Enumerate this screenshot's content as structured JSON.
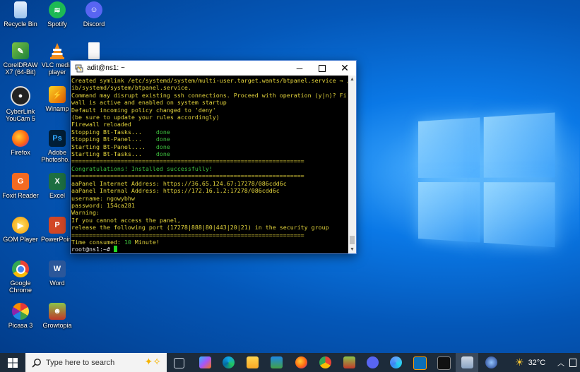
{
  "desktop": {
    "icons": [
      {
        "label": "Recycle Bin"
      },
      {
        "label": "Spotify"
      },
      {
        "label": "Discord"
      },
      {
        "label": "CorelDRAW X7 (64-Bit)"
      },
      {
        "label": "VLC media player"
      },
      {
        "label": ""
      },
      {
        "label": "CyberLink YouCam 5"
      },
      {
        "label": "Winamp"
      },
      {
        "label": "Firefox"
      },
      {
        "label": "Adobe Photosho..."
      },
      {
        "label": "Foxit Reader"
      },
      {
        "label": "Excel"
      },
      {
        "label": "GOM Player"
      },
      {
        "label": "PowerPoint"
      },
      {
        "label": "Google Chrome"
      },
      {
        "label": "Word"
      },
      {
        "label": "Picasa 3"
      },
      {
        "label": "Growtopia"
      }
    ]
  },
  "terminal": {
    "title": "adit@ns1: ~",
    "lines": [
      "Created symlink /etc/systemd/system/multi-user.target.wants/btpanel.service → /l",
      "ib/systemd/system/btpanel.service.",
      "Command may disrupt existing ssh connections. Proceed with operation (y|n)? Fire",
      "wall is active and enabled on system startup",
      "Default incoming policy changed to 'deny'",
      "(be sure to update your rules accordingly)",
      "Firewall reloaded"
    ],
    "tasks": [
      {
        "name": "Stopping Bt-Tasks...    ",
        "status": "done"
      },
      {
        "name": "Stopping Bt-Panel...    ",
        "status": "done"
      },
      {
        "name": "Starting Bt-Panel....   ",
        "status": "done"
      },
      {
        "name": "Starting Bt-Tasks...    ",
        "status": "done"
      }
    ],
    "separator": "==================================================================",
    "congrats": "Congratulations! Installed successfully!",
    "info_lines": [
      "aaPanel Internet Address: https://36.65.124.67:17278/086cdd6c",
      "aaPanel Internal Address: https://172.16.1.2:17278/086cdd6c",
      "username: ngowybhw",
      "password: 154ca281",
      "Warning:",
      "If you cannot access the panel,",
      "release the following port (17278|888|80|443|20|21) in the security group"
    ],
    "time_prefix": "Time consumed: ",
    "time_value": "10",
    "time_suffix": " Minute!",
    "prompt": "root@ns1:~# "
  },
  "taskbar": {
    "search_placeholder": "Type here to search",
    "temperature": "32°C"
  }
}
